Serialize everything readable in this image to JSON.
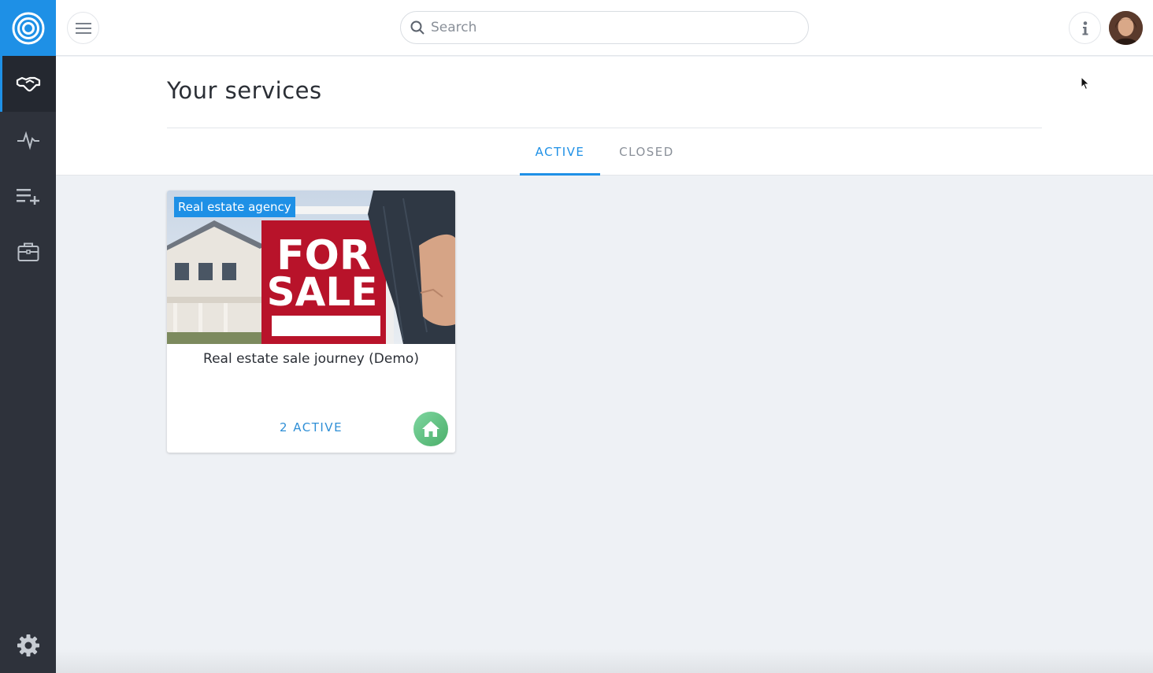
{
  "topbar": {
    "search_placeholder": "Search"
  },
  "icons": {
    "logo": "target-rings-icon",
    "menu": "hamburger-icon",
    "search": "search-icon",
    "info": "info-icon",
    "nav": [
      "handshake-icon",
      "pulse-icon",
      "playlist-add-icon",
      "briefcase-icon"
    ],
    "settings": "gear-icon",
    "card_badge": "home-icon"
  },
  "page": {
    "title": "Your services"
  },
  "tabs": [
    {
      "label": "ACTIVE",
      "active": true
    },
    {
      "label": "CLOSED",
      "active": false
    }
  ],
  "cards": [
    {
      "tag": "Real estate agency",
      "image_sign_line1": "FOR",
      "image_sign_line2": "SALE",
      "title": "Real estate sale journey (Demo)",
      "count": "2 ACTIVE"
    }
  ],
  "colors": {
    "accent": "#1e90e6",
    "sidebar": "#2e323b",
    "background": "#eef1f5",
    "badge_green": "#5cbf7a"
  }
}
